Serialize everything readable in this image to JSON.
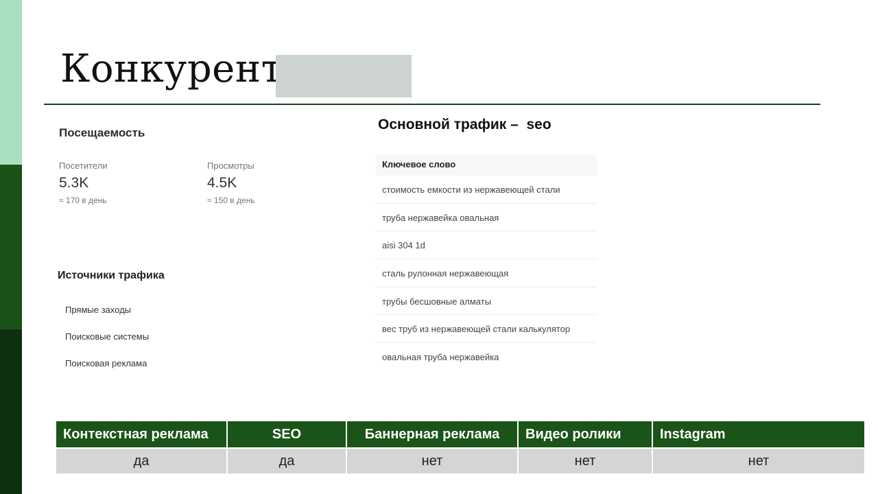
{
  "slide": {
    "title": "Конкурент:"
  },
  "stats": {
    "heading": "Посещаемость",
    "visitors": {
      "label": "Посетители",
      "value": "5.3K",
      "per_day": "≈ 170 в день"
    },
    "views": {
      "label": "Просмотры",
      "value": "4.5K",
      "per_day": "≈ 150 в день"
    }
  },
  "sources": {
    "heading": "Источники трафика",
    "items": [
      "Прямые заходы",
      "Поисковые системы",
      "Поисковая реклама"
    ]
  },
  "traffic": {
    "heading": "Основной трафик –  seo"
  },
  "keywords": {
    "header": "Ключевое слово",
    "rows": [
      "стоимость емкости из нержавеющей стали",
      "труба нержавейка овальная",
      "aisi 304 1d",
      "сталь рулонная нержавеющая",
      "трубы бесшовные алматы",
      "вес труб из нержавеющей стали калькулятор",
      "овальная труба нержавейка"
    ]
  },
  "channels": {
    "headers": [
      "Контекстная реклама",
      "SEO",
      "Баннерная реклама",
      "Видео ролики",
      "Instagram"
    ],
    "values": [
      "да",
      "да",
      "нет",
      "нет",
      "нет"
    ]
  },
  "colors": {
    "accent_light": "#a8e0bf",
    "accent_dark": "#1b5418",
    "redaction": "#cdd3cf"
  }
}
